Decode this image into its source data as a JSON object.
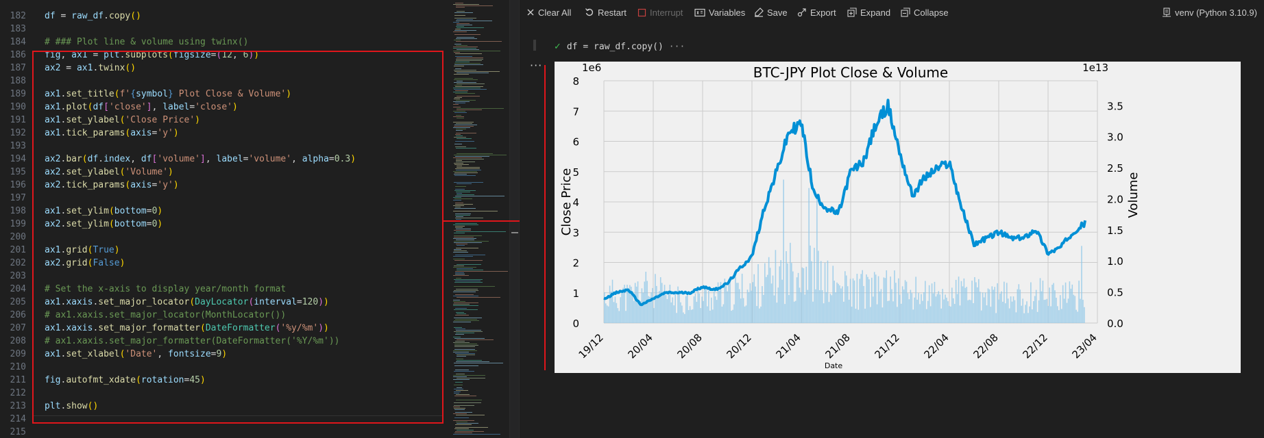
{
  "editor": {
    "lines": [
      {
        "n": "182",
        "segs": [
          [
            "df",
            "t-var"
          ],
          [
            " = ",
            "t-op"
          ],
          [
            "raw_df",
            "t-var"
          ],
          [
            ".",
            "t-op"
          ],
          [
            "copy",
            "t-fn"
          ],
          [
            "()",
            "t-p1"
          ]
        ]
      },
      {
        "n": "183",
        "segs": []
      },
      {
        "n": "184",
        "segs": [
          [
            "# ### Plot line & volume using twinx()",
            "t-com"
          ]
        ]
      },
      {
        "n": "186",
        "segs": [
          [
            "fig",
            "t-var"
          ],
          [
            ", ",
            "t-op"
          ],
          [
            "ax1",
            "t-var"
          ],
          [
            " = ",
            "t-op"
          ],
          [
            "plt",
            "t-var"
          ],
          [
            ".",
            "t-op"
          ],
          [
            "subplots",
            "t-fn"
          ],
          [
            "(",
            "t-p1"
          ],
          [
            "figsize",
            "t-var"
          ],
          [
            "=",
            "t-op"
          ],
          [
            "(",
            "t-p2"
          ],
          [
            "12",
            "t-num"
          ],
          [
            ", ",
            "t-op"
          ],
          [
            "6",
            "t-num"
          ],
          [
            ")",
            "t-p2"
          ],
          [
            ")",
            "t-p1"
          ]
        ]
      },
      {
        "n": "187",
        "segs": [
          [
            "ax2",
            "t-var"
          ],
          [
            " = ",
            "t-op"
          ],
          [
            "ax1",
            "t-var"
          ],
          [
            ".",
            "t-op"
          ],
          [
            "twinx",
            "t-fn"
          ],
          [
            "()",
            "t-p1"
          ]
        ]
      },
      {
        "n": "188",
        "segs": []
      },
      {
        "n": "189",
        "segs": [
          [
            "ax1",
            "t-var"
          ],
          [
            ".",
            "t-op"
          ],
          [
            "set_title",
            "t-fn"
          ],
          [
            "(",
            "t-p1"
          ],
          [
            "f'",
            "t-str"
          ],
          [
            "{",
            "t-kw"
          ],
          [
            "symbol",
            "t-var"
          ],
          [
            "}",
            "t-kw"
          ],
          [
            " Plot Close & Volume'",
            "t-str"
          ],
          [
            ")",
            "t-p1"
          ]
        ]
      },
      {
        "n": "190",
        "segs": [
          [
            "ax1",
            "t-var"
          ],
          [
            ".",
            "t-op"
          ],
          [
            "plot",
            "t-fn"
          ],
          [
            "(",
            "t-p1"
          ],
          [
            "df",
            "t-var"
          ],
          [
            "[",
            "t-p2"
          ],
          [
            "'close'",
            "t-str"
          ],
          [
            "]",
            "t-p2"
          ],
          [
            ", ",
            "t-op"
          ],
          [
            "label",
            "t-var"
          ],
          [
            "=",
            "t-op"
          ],
          [
            "'close'",
            "t-str"
          ],
          [
            ")",
            "t-p1"
          ]
        ]
      },
      {
        "n": "191",
        "segs": [
          [
            "ax1",
            "t-var"
          ],
          [
            ".",
            "t-op"
          ],
          [
            "set_ylabel",
            "t-fn"
          ],
          [
            "(",
            "t-p1"
          ],
          [
            "'Close Price'",
            "t-str"
          ],
          [
            ")",
            "t-p1"
          ]
        ]
      },
      {
        "n": "192",
        "segs": [
          [
            "ax1",
            "t-var"
          ],
          [
            ".",
            "t-op"
          ],
          [
            "tick_params",
            "t-fn"
          ],
          [
            "(",
            "t-p1"
          ],
          [
            "axis",
            "t-var"
          ],
          [
            "=",
            "t-op"
          ],
          [
            "'y'",
            "t-str"
          ],
          [
            ")",
            "t-p1"
          ]
        ]
      },
      {
        "n": "193",
        "segs": []
      },
      {
        "n": "194",
        "segs": [
          [
            "ax2",
            "t-var"
          ],
          [
            ".",
            "t-op"
          ],
          [
            "bar",
            "t-fn"
          ],
          [
            "(",
            "t-p1"
          ],
          [
            "df",
            "t-var"
          ],
          [
            ".",
            "t-op"
          ],
          [
            "index",
            "t-var"
          ],
          [
            ", ",
            "t-op"
          ],
          [
            "df",
            "t-var"
          ],
          [
            "[",
            "t-p2"
          ],
          [
            "'volume'",
            "t-str"
          ],
          [
            "]",
            "t-p2"
          ],
          [
            ", ",
            "t-op"
          ],
          [
            "label",
            "t-var"
          ],
          [
            "=",
            "t-op"
          ],
          [
            "'volume'",
            "t-str"
          ],
          [
            ", ",
            "t-op"
          ],
          [
            "alpha",
            "t-var"
          ],
          [
            "=",
            "t-op"
          ],
          [
            "0.3",
            "t-num"
          ],
          [
            ")",
            "t-p1"
          ]
        ]
      },
      {
        "n": "195",
        "segs": [
          [
            "ax2",
            "t-var"
          ],
          [
            ".",
            "t-op"
          ],
          [
            "set_ylabel",
            "t-fn"
          ],
          [
            "(",
            "t-p1"
          ],
          [
            "'Volume'",
            "t-str"
          ],
          [
            ")",
            "t-p1"
          ]
        ]
      },
      {
        "n": "196",
        "segs": [
          [
            "ax2",
            "t-var"
          ],
          [
            ".",
            "t-op"
          ],
          [
            "tick_params",
            "t-fn"
          ],
          [
            "(",
            "t-p1"
          ],
          [
            "axis",
            "t-var"
          ],
          [
            "=",
            "t-op"
          ],
          [
            "'y'",
            "t-str"
          ],
          [
            ")",
            "t-p1"
          ]
        ]
      },
      {
        "n": "197",
        "segs": []
      },
      {
        "n": "198",
        "segs": [
          [
            "ax1",
            "t-var"
          ],
          [
            ".",
            "t-op"
          ],
          [
            "set_ylim",
            "t-fn"
          ],
          [
            "(",
            "t-p1"
          ],
          [
            "bottom",
            "t-var"
          ],
          [
            "=",
            "t-op"
          ],
          [
            "0",
            "t-num"
          ],
          [
            ")",
            "t-p1"
          ]
        ]
      },
      {
        "n": "199",
        "segs": [
          [
            "ax2",
            "t-var"
          ],
          [
            ".",
            "t-op"
          ],
          [
            "set_ylim",
            "t-fn"
          ],
          [
            "(",
            "t-p1"
          ],
          [
            "bottom",
            "t-var"
          ],
          [
            "=",
            "t-op"
          ],
          [
            "0",
            "t-num"
          ],
          [
            ")",
            "t-p1"
          ]
        ]
      },
      {
        "n": "200",
        "segs": []
      },
      {
        "n": "201",
        "segs": [
          [
            "ax1",
            "t-var"
          ],
          [
            ".",
            "t-op"
          ],
          [
            "grid",
            "t-fn"
          ],
          [
            "(",
            "t-p1"
          ],
          [
            "True",
            "t-bool"
          ],
          [
            ")",
            "t-p1"
          ]
        ]
      },
      {
        "n": "202",
        "segs": [
          [
            "ax2",
            "t-var"
          ],
          [
            ".",
            "t-op"
          ],
          [
            "grid",
            "t-fn"
          ],
          [
            "(",
            "t-p1"
          ],
          [
            "False",
            "t-bool"
          ],
          [
            ")",
            "t-p1"
          ]
        ]
      },
      {
        "n": "203",
        "segs": []
      },
      {
        "n": "204",
        "segs": [
          [
            "# Set the x-axis to display year/month format",
            "t-com"
          ]
        ]
      },
      {
        "n": "205",
        "segs": [
          [
            "ax1",
            "t-var"
          ],
          [
            ".",
            "t-op"
          ],
          [
            "xaxis",
            "t-var"
          ],
          [
            ".",
            "t-op"
          ],
          [
            "set_major_locator",
            "t-fn"
          ],
          [
            "(",
            "t-p1"
          ],
          [
            "DayLocator",
            "t-cls"
          ],
          [
            "(",
            "t-p2"
          ],
          [
            "interval",
            "t-var"
          ],
          [
            "=",
            "t-op"
          ],
          [
            "120",
            "t-num"
          ],
          [
            ")",
            "t-p2"
          ],
          [
            ")",
            "t-p1"
          ]
        ]
      },
      {
        "n": "206",
        "segs": [
          [
            "# ax1.xaxis.set_major_locator(MonthLocator())",
            "t-com"
          ]
        ]
      },
      {
        "n": "207",
        "segs": [
          [
            "ax1",
            "t-var"
          ],
          [
            ".",
            "t-op"
          ],
          [
            "xaxis",
            "t-var"
          ],
          [
            ".",
            "t-op"
          ],
          [
            "set_major_formatter",
            "t-fn"
          ],
          [
            "(",
            "t-p1"
          ],
          [
            "DateFormatter",
            "t-cls"
          ],
          [
            "(",
            "t-p2"
          ],
          [
            "'%y/%m'",
            "t-str"
          ],
          [
            ")",
            "t-p2"
          ],
          [
            ")",
            "t-p1"
          ]
        ]
      },
      {
        "n": "208",
        "segs": [
          [
            "# ax1.xaxis.set_major_formatter(DateFormatter('%Y/%m'))",
            "t-com"
          ]
        ]
      },
      {
        "n": "209",
        "segs": [
          [
            "ax1",
            "t-var"
          ],
          [
            ".",
            "t-op"
          ],
          [
            "set_xlabel",
            "t-fn"
          ],
          [
            "(",
            "t-p1"
          ],
          [
            "'Date'",
            "t-str"
          ],
          [
            ", ",
            "t-op"
          ],
          [
            "fontsize",
            "t-var"
          ],
          [
            "=",
            "t-op"
          ],
          [
            "9",
            "t-num"
          ],
          [
            ")",
            "t-p1"
          ]
        ]
      },
      {
        "n": "210",
        "segs": []
      },
      {
        "n": "211",
        "segs": [
          [
            "fig",
            "t-var"
          ],
          [
            ".",
            "t-op"
          ],
          [
            "autofmt_xdate",
            "t-fn"
          ],
          [
            "(",
            "t-p1"
          ],
          [
            "rotation",
            "t-var"
          ],
          [
            "=",
            "t-op"
          ],
          [
            "45",
            "t-num"
          ],
          [
            ")",
            "t-p1"
          ]
        ]
      },
      {
        "n": "212",
        "segs": []
      },
      {
        "n": "213",
        "segs": [
          [
            "plt",
            "t-var"
          ],
          [
            ".",
            "t-op"
          ],
          [
            "show",
            "t-fn"
          ],
          [
            "()",
            "t-p1"
          ]
        ]
      },
      {
        "n": "214",
        "segs": []
      },
      {
        "n": "215",
        "segs": []
      }
    ]
  },
  "toolbar": {
    "clear_all": "Clear All",
    "restart": "Restart",
    "interrupt": "Interrupt",
    "variables": "Variables",
    "save": "Save",
    "export": "Export",
    "expand": "Expand",
    "collapse": "Collapse",
    "kernel": "venv (Python 3.10.9)"
  },
  "cell": {
    "code": "df = raw_df.copy()",
    "ellipsis": "···",
    "output_menu": "···"
  },
  "chart_data": {
    "type": "line",
    "title": "BTC-JPY Plot Close & Volume",
    "xlabel": "Date",
    "ylabel": "Close Price",
    "y2label": "Volume",
    "y_offset_label": "1e6",
    "y2_offset_label": "1e13",
    "x_ticks": [
      "19/12",
      "20/04",
      "20/08",
      "20/12",
      "21/04",
      "21/08",
      "21/12",
      "22/04",
      "22/08",
      "22/12",
      "23/04"
    ],
    "y_ticks": [
      "0",
      "1",
      "2",
      "3",
      "4",
      "5",
      "6",
      "7",
      "8"
    ],
    "y2_ticks": [
      "0.0",
      "0.5",
      "1.0",
      "1.5",
      "2.0",
      "2.5",
      "3.0",
      "3.5"
    ],
    "ylim": [
      0,
      8
    ],
    "y2lim": [
      0,
      3.9
    ],
    "grid": true,
    "line_color": "#008fd5",
    "bar_color": "#8ec7e8",
    "series": [
      {
        "name": "close",
        "x": [
          "19/12",
          "20/01",
          "20/02",
          "20/03",
          "20/04",
          "20/05",
          "20/06",
          "20/07",
          "20/08",
          "20/09",
          "20/10",
          "20/11",
          "20/12",
          "21/01",
          "21/02",
          "21/03",
          "21/04",
          "21/05",
          "21/06",
          "21/07",
          "21/08",
          "21/09",
          "21/10",
          "21/11",
          "21/12",
          "22/01",
          "22/02",
          "22/03",
          "22/04",
          "22/05",
          "22/06",
          "22/07",
          "22/08",
          "22/09",
          "22/10",
          "22/11",
          "22/12",
          "23/01",
          "23/02",
          "23/03"
        ],
        "values": [
          0.8,
          1.0,
          1.1,
          0.6,
          0.8,
          1.0,
          1.0,
          1.0,
          1.2,
          1.1,
          1.3,
          1.8,
          2.2,
          3.8,
          5.0,
          6.3,
          6.6,
          4.3,
          3.8,
          3.6,
          5.0,
          5.3,
          6.5,
          7.2,
          5.6,
          4.2,
          4.8,
          5.1,
          5.3,
          3.8,
          2.6,
          2.8,
          3.0,
          2.8,
          2.8,
          3.1,
          2.3,
          2.5,
          3.0,
          3.3
        ]
      },
      {
        "name": "volume",
        "x": [
          "19/12",
          "20/01",
          "20/02",
          "20/03",
          "20/04",
          "20/05",
          "20/06",
          "20/07",
          "20/08",
          "20/09",
          "20/10",
          "20/11",
          "20/12",
          "21/01",
          "21/02",
          "21/03",
          "21/04",
          "21/05",
          "21/06",
          "21/07",
          "21/08",
          "21/09",
          "21/10",
          "21/11",
          "21/12",
          "22/01",
          "22/02",
          "22/03",
          "22/04",
          "22/05",
          "22/06",
          "22/07",
          "22/08",
          "22/09",
          "22/10",
          "22/11",
          "22/12",
          "23/01",
          "23/02",
          "23/03"
        ],
        "values": [
          0.45,
          0.5,
          0.45,
          0.6,
          0.55,
          0.45,
          0.4,
          0.4,
          0.45,
          0.45,
          0.5,
          0.55,
          0.6,
          0.7,
          0.8,
          0.9,
          1.0,
          0.85,
          0.7,
          0.6,
          0.55,
          0.6,
          0.55,
          0.6,
          0.55,
          0.5,
          0.5,
          0.45,
          0.45,
          0.55,
          0.5,
          0.45,
          0.45,
          0.45,
          0.4,
          0.5,
          0.55,
          0.45,
          0.45,
          0.5
        ]
      }
    ]
  }
}
